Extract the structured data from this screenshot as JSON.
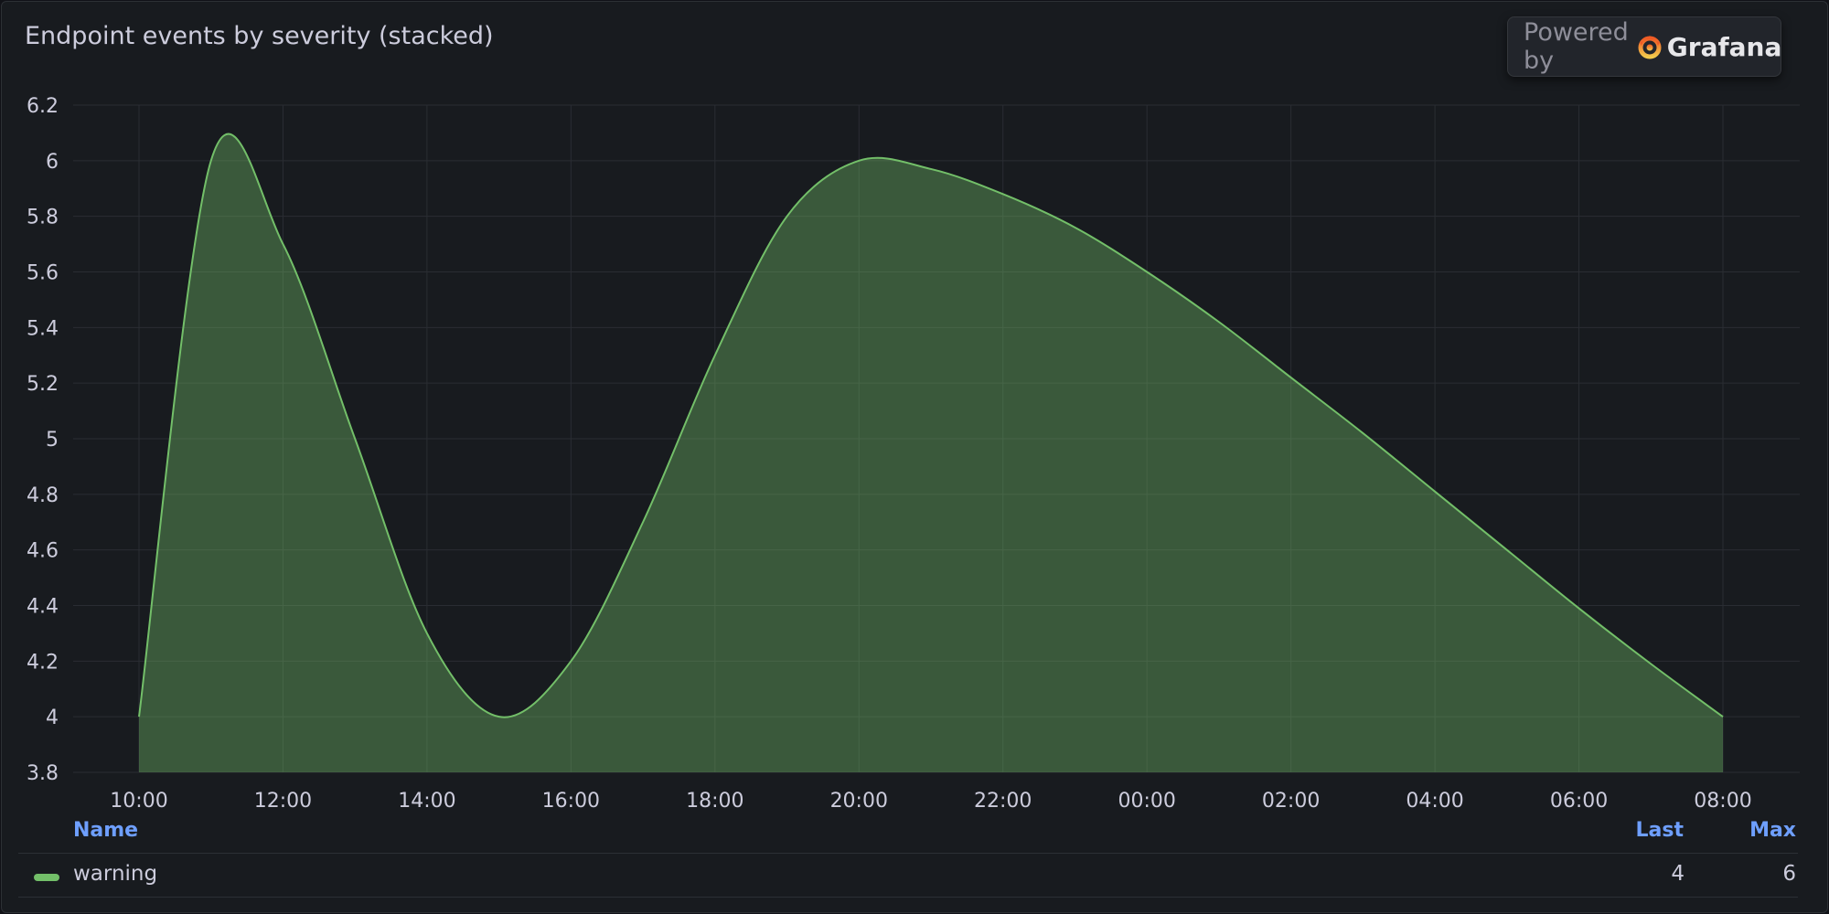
{
  "panel": {
    "title": "Endpoint events by severity (stacked)"
  },
  "badge": {
    "powered_by": "Powered by",
    "brand": "Grafana"
  },
  "colors": {
    "series": "#73bf69",
    "accent": "#6e9fff",
    "background": "#181b1f",
    "grid": "#2a2d33"
  },
  "legend": {
    "headers": {
      "name": "Name",
      "last": "Last",
      "max": "Max"
    },
    "rows": [
      {
        "name": "warning",
        "last": "4",
        "max": "6"
      }
    ]
  },
  "chart_data": {
    "type": "area",
    "title": "Endpoint events by severity (stacked)",
    "x_ticks": [
      "10:00",
      "12:00",
      "14:00",
      "16:00",
      "18:00",
      "20:00",
      "22:00",
      "00:00",
      "02:00",
      "04:00",
      "06:00",
      "08:00"
    ],
    "y_ticks": [
      "3.8",
      "4",
      "4.2",
      "4.4",
      "4.6",
      "4.8",
      "5",
      "5.2",
      "5.4",
      "5.6",
      "5.8",
      "6",
      "6.2"
    ],
    "ylim": [
      3.8,
      6.2
    ],
    "xlim_hours_from_first_tick": [
      0,
      22
    ],
    "grid": true,
    "legend_placement": "bottom",
    "series": [
      {
        "name": "warning",
        "color": "#73bf69",
        "x": [
          "10:00",
          "11:00",
          "12:00",
          "13:00",
          "14:00",
          "15:00",
          "16:00",
          "17:00",
          "18:00",
          "19:00",
          "20:00",
          "21:00",
          "22:00",
          "23:00",
          "00:00",
          "01:00",
          "02:00",
          "03:00",
          "04:00",
          "05:00",
          "06:00",
          "07:00",
          "08:00"
        ],
        "values": [
          4,
          6,
          5.7,
          5.0,
          4.3,
          4.0,
          4.2,
          4.7,
          5.3,
          5.8,
          6,
          5.97,
          5.88,
          5.76,
          5.6,
          5.42,
          5.22,
          5.02,
          4.81,
          4.6,
          4.39,
          4.19,
          4
        ]
      }
    ]
  }
}
